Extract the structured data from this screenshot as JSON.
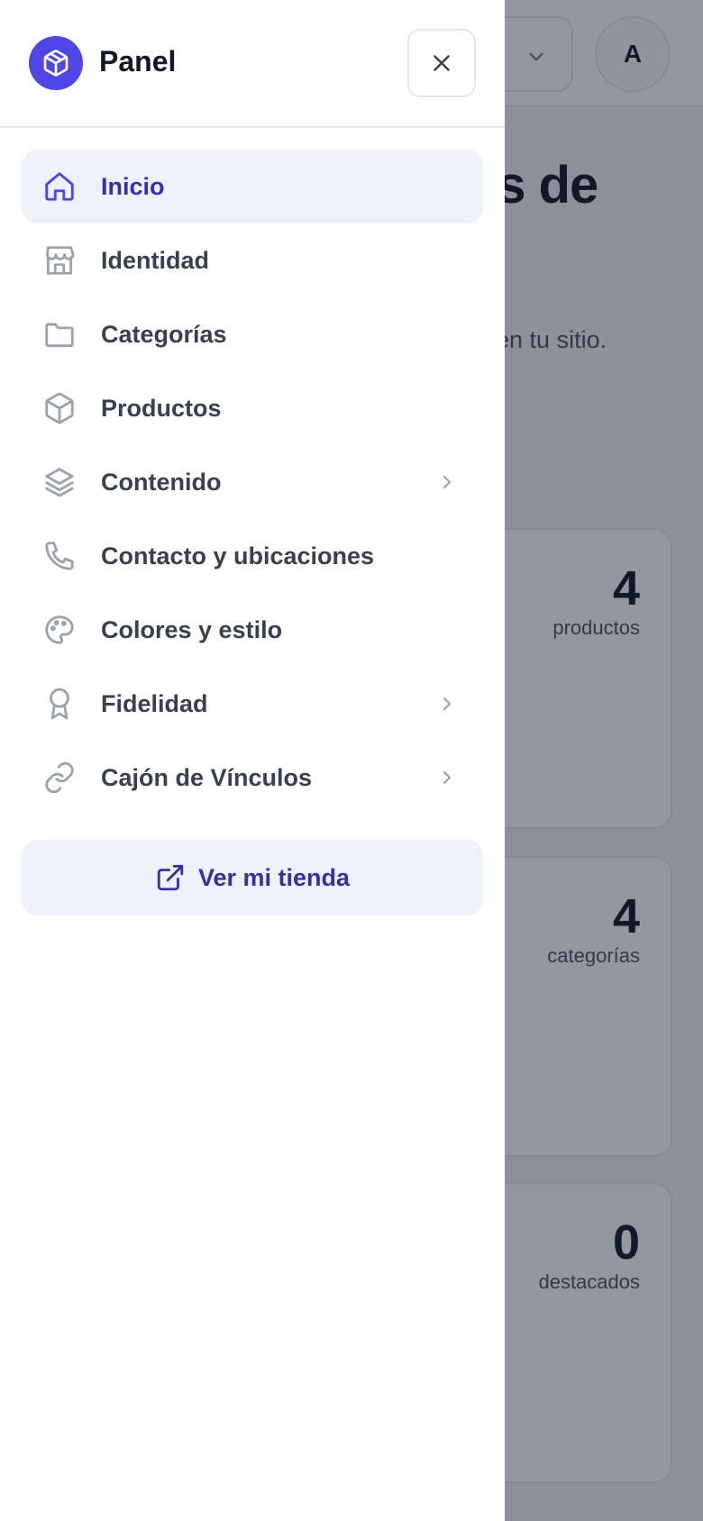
{
  "background": {
    "avatar_initial": "A",
    "page_title_fragment": "és de",
    "subtitle_fragment": "te en tu sitio.",
    "stats": [
      {
        "value": "4",
        "label": "productos"
      },
      {
        "value": "4",
        "label": "categorías"
      },
      {
        "value": "0",
        "label": "destacados"
      }
    ]
  },
  "drawer": {
    "title": "Panel",
    "logo_icon": "box-icon",
    "close_icon": "close-icon",
    "nav": [
      {
        "label": "Inicio",
        "icon": "home-icon",
        "active": true,
        "has_submenu": false
      },
      {
        "label": "Identidad",
        "icon": "store-icon",
        "active": false,
        "has_submenu": false
      },
      {
        "label": "Categorías",
        "icon": "folder-icon",
        "active": false,
        "has_submenu": false
      },
      {
        "label": "Productos",
        "icon": "box-icon",
        "active": false,
        "has_submenu": false
      },
      {
        "label": "Contenido",
        "icon": "layers-icon",
        "active": false,
        "has_submenu": true
      },
      {
        "label": "Contacto y ubicaciones",
        "icon": "phone-icon",
        "active": false,
        "has_submenu": false
      },
      {
        "label": "Colores y estilo",
        "icon": "palette-icon",
        "active": false,
        "has_submenu": false
      },
      {
        "label": "Fidelidad",
        "icon": "award-icon",
        "active": false,
        "has_submenu": true
      },
      {
        "label": "Cajón de Vínculos",
        "icon": "link-icon",
        "active": false,
        "has_submenu": true
      }
    ],
    "store_button": {
      "label": "Ver mi tienda",
      "icon": "external-link-icon"
    }
  },
  "colors": {
    "accent": "#4f46e5",
    "accent_text": "#3730a3",
    "active_bg": "#eef0fb",
    "icon_gray": "#9ca3af",
    "overlay": "rgba(17,24,39,0.45)"
  }
}
